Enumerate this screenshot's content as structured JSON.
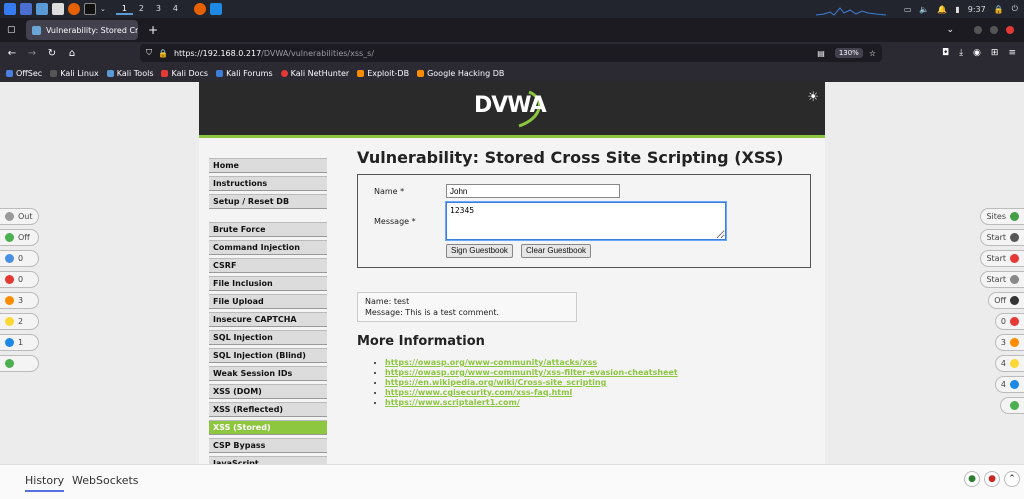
{
  "taskbar": {
    "workspaces": [
      "1",
      "2",
      "3",
      "4"
    ],
    "clock": "9:37"
  },
  "browser": {
    "tab_title": "Vulnerability: Stored Cro",
    "url_host": "https://192.168.0.217",
    "url_path": "/DVWA/vulnerabilities/xss_s/",
    "zoom": "130%",
    "bookmarks": [
      "OffSec",
      "Kali Linux",
      "Kali Tools",
      "Kali Docs",
      "Kali Forums",
      "Kali NetHunter",
      "Exploit-DB",
      "Google Hacking DB"
    ]
  },
  "dvwa": {
    "logo": "DVWA",
    "menu_group1": [
      "Home",
      "Instructions",
      "Setup / Reset DB"
    ],
    "menu_group2": [
      "Brute Force",
      "Command Injection",
      "CSRF",
      "File Inclusion",
      "File Upload",
      "Insecure CAPTCHA",
      "SQL Injection",
      "SQL Injection (Blind)",
      "Weak Session IDs",
      "XSS (DOM)",
      "XSS (Reflected)",
      "XSS (Stored)",
      "CSP Bypass",
      "JavaScript"
    ],
    "selected_menu": "XSS (Stored)",
    "page_title": "Vulnerability: Stored Cross Site Scripting (XSS)",
    "form": {
      "name_label": "Name *",
      "name_value": "John",
      "message_label": "Message *",
      "message_value": "12345",
      "sign_button": "Sign Guestbook",
      "clear_button": "Clear Guestbook"
    },
    "comment": {
      "name_line": "Name: test",
      "message_line": "Message: This is a test comment."
    },
    "more_info_title": "More Information",
    "links": [
      "https://owasp.org/www-community/attacks/xss",
      "https://owasp.org/www-community/xss-filter-evasion-cheatsheet",
      "https://en.wikipedia.org/wiki/Cross-site_scripting",
      "https://www.cgisecurity.com/xss-faq.html",
      "https://www.scriptalert1.com/"
    ]
  },
  "hud_left": [
    {
      "label": "Out",
      "color": "#9a9a9a"
    },
    {
      "label": "Off",
      "color": "#4caf50"
    },
    {
      "label": "0",
      "color": "#4a90e2"
    },
    {
      "label": "0",
      "color": "#e53935"
    },
    {
      "label": "3",
      "color": "#fb8c00"
    },
    {
      "label": "2",
      "color": "#fdd835"
    },
    {
      "label": "1",
      "color": "#1e88e5"
    },
    {
      "label": "",
      "color": "#4caf50"
    }
  ],
  "hud_right": [
    {
      "label": "Sites",
      "color": "#43a047"
    },
    {
      "label": "Start",
      "color": "#555555"
    },
    {
      "label": "Start",
      "color": "#e53935"
    },
    {
      "label": "Start",
      "color": "#888888"
    },
    {
      "label": "Off",
      "color": "#333333"
    },
    {
      "label": "0",
      "color": "#e53935"
    },
    {
      "label": "3",
      "color": "#fb8c00"
    },
    {
      "label": "4",
      "color": "#fdd835"
    },
    {
      "label": "4",
      "color": "#1e88e5"
    },
    {
      "label": "",
      "color": "#4caf50"
    }
  ],
  "bottom": {
    "tab_history": "History",
    "tab_websockets": "WebSockets"
  }
}
